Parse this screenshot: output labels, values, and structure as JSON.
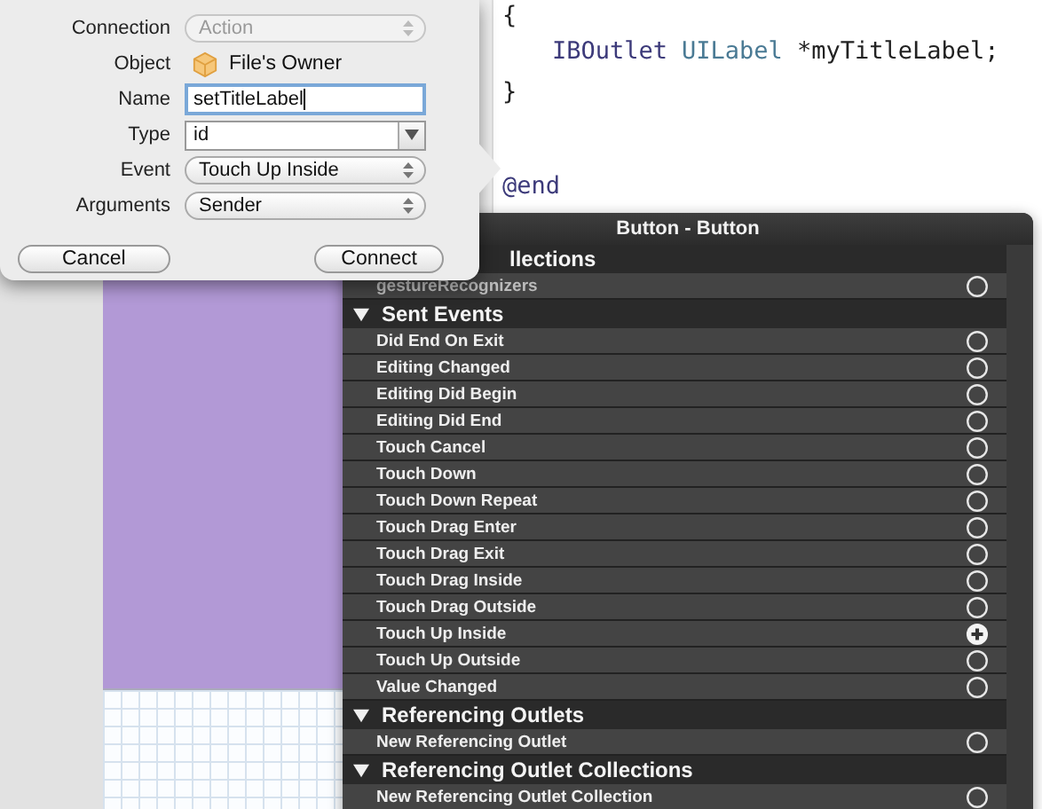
{
  "code_editor": {
    "lines": [
      {
        "kind": "brace",
        "tokens": [
          {
            "kind": "plain",
            "text": "{"
          }
        ]
      },
      {
        "kind": "member",
        "tokens": [
          {
            "kind": "keyword",
            "text": "IBOutlet"
          },
          {
            "kind": "type",
            "text": "UILabel"
          },
          {
            "kind": "plain",
            "text": "*myTitleLabel;"
          }
        ]
      },
      {
        "kind": "brace",
        "tokens": [
          {
            "kind": "plain",
            "text": "}"
          }
        ]
      },
      {
        "kind": "end",
        "tokens": [
          {
            "kind": "directive",
            "text": "@end"
          }
        ]
      }
    ]
  },
  "connection_popover": {
    "fields": [
      {
        "label": "Connection",
        "kind": "select",
        "value": "Action",
        "disabled": true
      },
      {
        "label": "Object",
        "kind": "object",
        "value": "File's Owner"
      },
      {
        "label": "Name",
        "kind": "text",
        "value": "setTitleLabel"
      },
      {
        "label": "Type",
        "kind": "combo",
        "value": "id"
      },
      {
        "label": "Event",
        "kind": "select",
        "value": "Touch Up Inside",
        "disabled": false
      },
      {
        "label": "Arguments",
        "kind": "select",
        "value": "Sender",
        "disabled": false
      }
    ],
    "buttons": [
      "Cancel",
      "Connect"
    ]
  },
  "connections_panel": {
    "title": "Button - Button",
    "sections": [
      {
        "title": "llections",
        "items": [
          {
            "label": "gestureRecognizers",
            "highlighted": false
          }
        ]
      },
      {
        "title": "Sent Events",
        "items": [
          {
            "label": "Did End On Exit",
            "highlighted": false
          },
          {
            "label": "Editing Changed",
            "highlighted": false
          },
          {
            "label": "Editing Did Begin",
            "highlighted": false
          },
          {
            "label": "Editing Did End",
            "highlighted": false
          },
          {
            "label": "Touch Cancel",
            "highlighted": false
          },
          {
            "label": "Touch Down",
            "highlighted": false
          },
          {
            "label": "Touch Down Repeat",
            "highlighted": false
          },
          {
            "label": "Touch Drag Enter",
            "highlighted": false
          },
          {
            "label": "Touch Drag Exit",
            "highlighted": false
          },
          {
            "label": "Touch Drag Inside",
            "highlighted": false
          },
          {
            "label": "Touch Drag Outside",
            "highlighted": false
          },
          {
            "label": "Touch Up Inside",
            "highlighted": true
          },
          {
            "label": "Touch Up Outside",
            "highlighted": false
          },
          {
            "label": "Value Changed",
            "highlighted": false
          }
        ]
      },
      {
        "title": "Referencing Outlets",
        "items": [
          {
            "label": "New Referencing Outlet",
            "highlighted": false
          }
        ]
      },
      {
        "title": "Referencing Outlet Collections",
        "items": [
          {
            "label": "New Referencing Outlet Collection",
            "highlighted": false
          }
        ]
      }
    ]
  }
}
